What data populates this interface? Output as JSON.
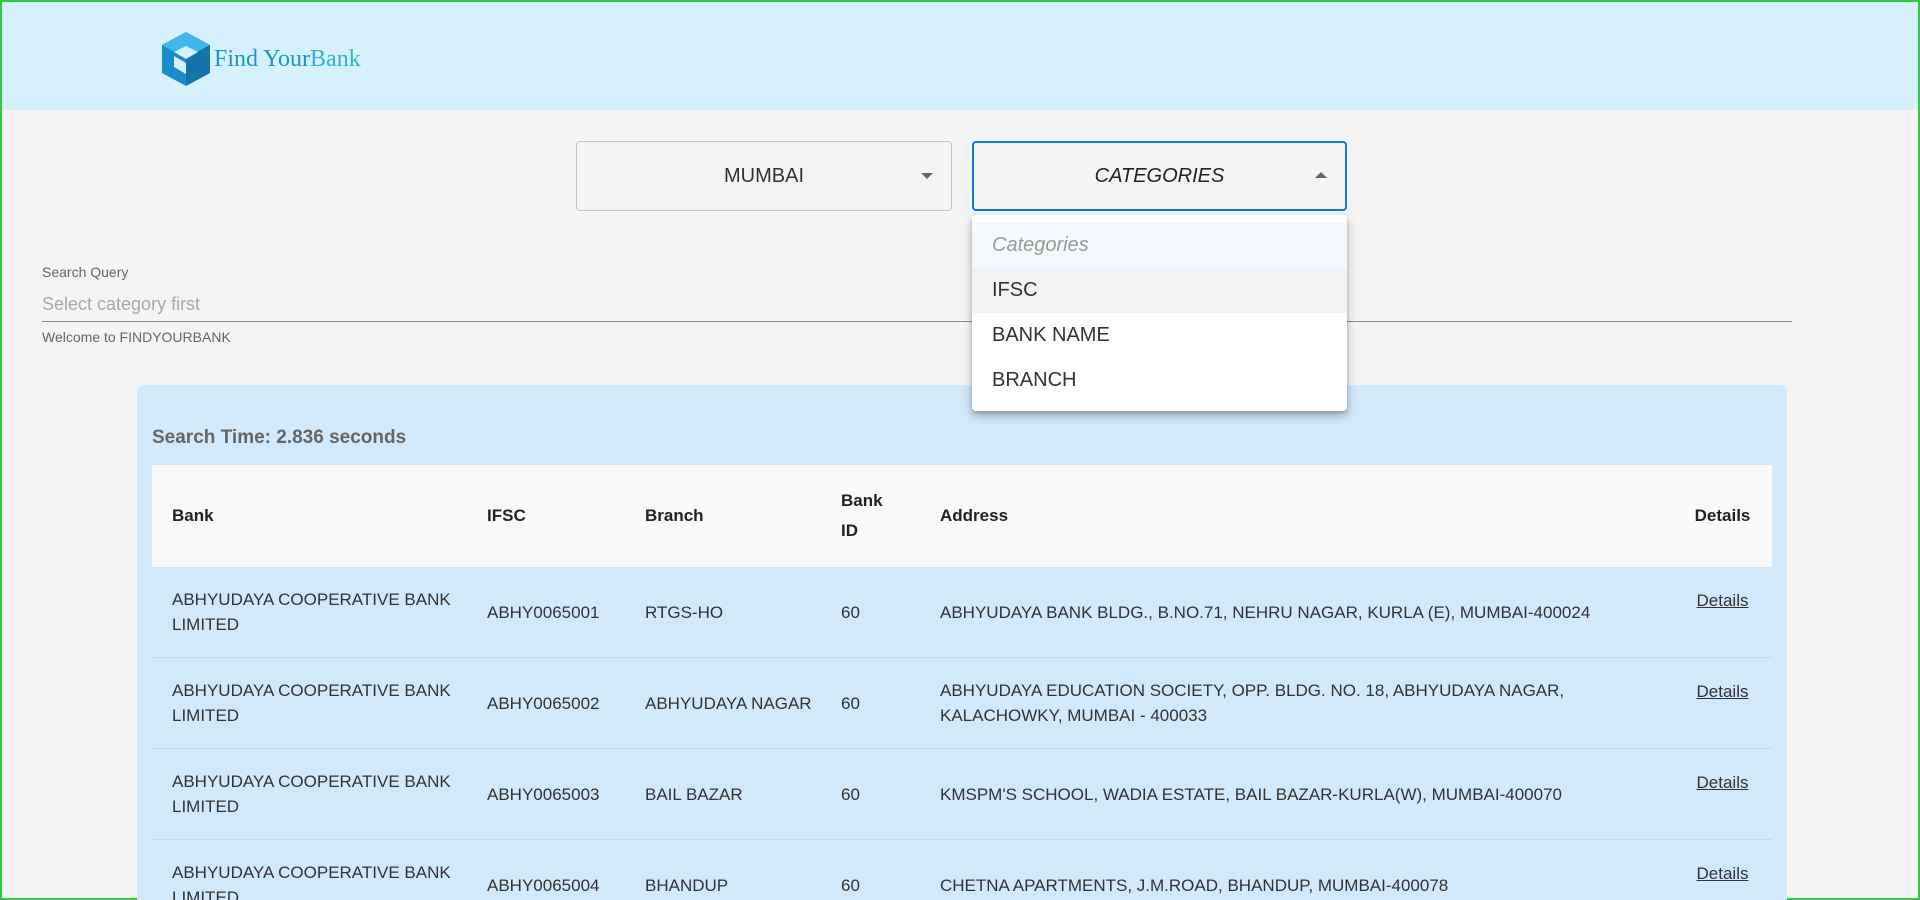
{
  "logo": {
    "text_first": "Find Your",
    "text_second": "Bank"
  },
  "filters": {
    "city": "MUMBAI",
    "category": "CATEGORIES"
  },
  "category_menu": {
    "header": "Categories",
    "options": [
      "IFSC",
      "BANK NAME",
      "BRANCH"
    ]
  },
  "search": {
    "label": "Search Query",
    "placeholder": "Select category first",
    "helper": "Welcome to FINDYOURBANK"
  },
  "results": {
    "search_time": "Search Time: 2.836 seconds",
    "columns": [
      "Bank",
      "IFSC",
      "Branch",
      "Bank ID",
      "Address",
      "Details"
    ],
    "rows": [
      {
        "bank": "ABHYUDAYA COOPERATIVE BANK LIMITED",
        "ifsc": "ABHY0065001",
        "branch": "RTGS-HO",
        "bank_id": "60",
        "address": "ABHYUDAYA BANK BLDG., B.NO.71, NEHRU NAGAR, KURLA (E), MUMBAI-400024",
        "details": "Details"
      },
      {
        "bank": "ABHYUDAYA COOPERATIVE BANK LIMITED",
        "ifsc": "ABHY0065002",
        "branch": "ABHYUDAYA NAGAR",
        "bank_id": "60",
        "address": "ABHYUDAYA EDUCATION SOCIETY, OPP. BLDG. NO. 18, ABHYUDAYA NAGAR, KALACHOWKY, MUMBAI - 400033",
        "details": "Details"
      },
      {
        "bank": "ABHYUDAYA COOPERATIVE BANK LIMITED",
        "ifsc": "ABHY0065003",
        "branch": "BAIL BAZAR",
        "bank_id": "60",
        "address": "KMSPM'S SCHOOL, WADIA ESTATE, BAIL BAZAR-KURLA(W), MUMBAI-400070",
        "details": "Details"
      },
      {
        "bank": "ABHYUDAYA COOPERATIVE BANK LIMITED",
        "ifsc": "ABHY0065004",
        "branch": "BHANDUP",
        "bank_id": "60",
        "address": "CHETNA APARTMENTS, J.M.ROAD, BHANDUP, MUMBAI-400078",
        "details": "Details"
      }
    ]
  }
}
